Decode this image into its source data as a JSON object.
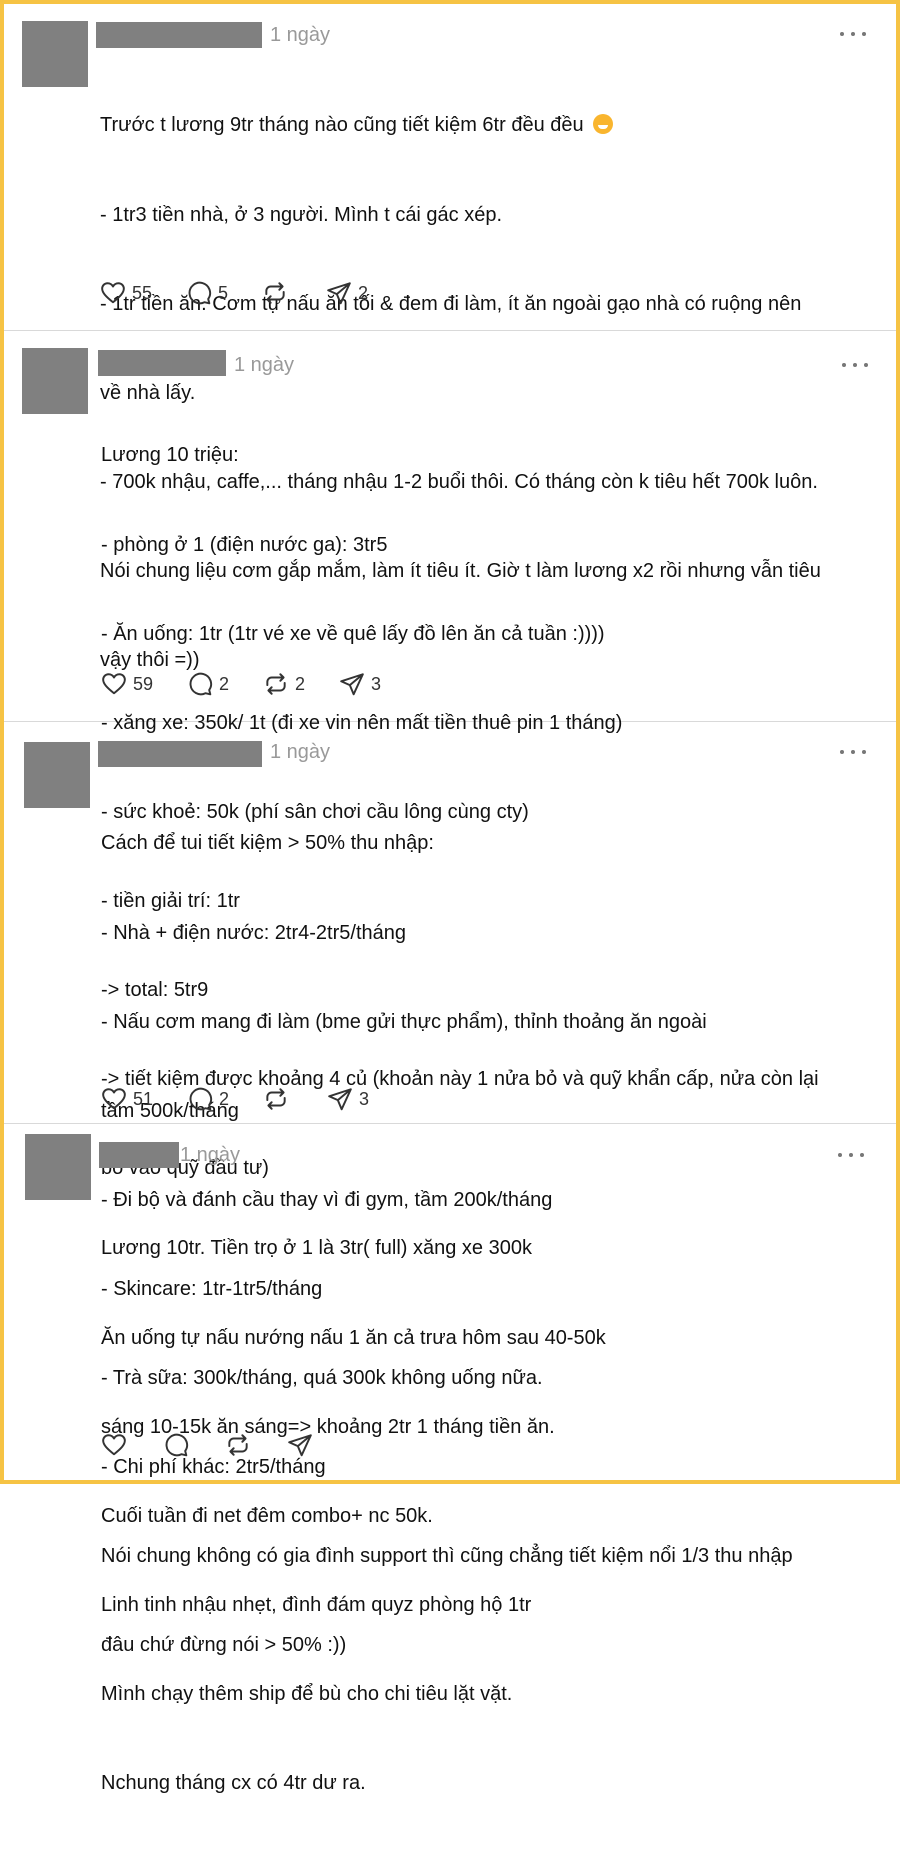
{
  "posts": [
    {
      "time": "1 ngày",
      "lines": [
        "Trước t lương 9tr tháng nào cũng tiết kiệm 6tr đều đều",
        "- 1tr3 tiền nhà, ở 3 người. Mình t cái gác xép.",
        "- 1tr tiền ăn. Cơm tự nấu ăn tối & đem đi làm, ít ăn ngoài gạo nhà có ruộng nên",
        "về nhà lấy.",
        "- 700k nhậu, caffe,... tháng nhậu 1-2 buổi thôi. Có tháng còn k tiêu hết 700k luôn.",
        "Nói chung liệu cơm gắp mắm, làm ít tiêu ít. Giờ t làm lương x2 rồi nhưng vẫn tiêu",
        "vậy thôi =))"
      ],
      "emoji": "grinning-sweat-emoji",
      "likes": "55",
      "replies": "5",
      "reposts": "",
      "shares": "2"
    },
    {
      "time": "1 ngày",
      "lines": [
        "Lương 10 triệu:",
        "- phòng ở 1 (điện nước ga): 3tr5",
        "- Ăn uống: 1tr (1tr vé xe về quê lấy đồ lên ăn cả tuần :))))",
        "- xăng xe: 350k/ 1t (đi xe vin nên mất tiền thuê pin 1 tháng)",
        "- sức khoẻ: 50k (phí sân chơi cầu lông cùng cty)",
        "- tiền giải trí: 1tr",
        "-> total: 5tr9",
        "-> tiết kiệm được khoảng 4 củ (khoản này 1 nửa bỏ và quỹ khẩn cấp, nửa còn lại",
        "bỏ vào quỹ đầu tư)"
      ],
      "likes": "59",
      "replies": "2",
      "reposts": "2",
      "shares": "3"
    },
    {
      "time": "1 ngày",
      "lines": [
        "Cách để tui tiết kiệm > 50% thu nhập:",
        "- Nhà + điện nước: 2tr4-2tr5/tháng",
        "- Nấu cơm mang đi làm (bme gửi thực phẩm), thỉnh thoảng ăn ngoài",
        "tầm 500k/tháng",
        "- Đi bộ và đánh cầu thay vì đi gym, tầm 200k/tháng",
        "- Skincare: 1tr-1tr5/tháng",
        "- Trà sữa: 300k/tháng, quá 300k không uống nữa.",
        "- Chi phí khác: 2tr5/tháng",
        "Nói chung không có gia đình support thì cũng chẳng tiết kiệm nổi 1/3 thu nhập",
        "đâu chứ đừng nói > 50% :))"
      ],
      "likes": "51",
      "replies": "2",
      "reposts": "",
      "shares": "3"
    },
    {
      "time": "1 ngày",
      "lines": [
        "Lương 10tr. Tiền trọ ở 1 là 3tr( full) xăng xe 300k",
        "Ăn uống tự nấu nướng nấu 1 ăn cả trưa hôm sau 40-50k",
        "sáng 10-15k ăn sáng=> khoảng 2tr 1 tháng tiền ăn.",
        "Cuối tuần đi net đêm combo+ nc 50k.",
        "Linh tinh nhậu nhẹt, đình đám quyz phòng hộ 1tr",
        "Mình chạy thêm ship để bù cho chi tiêu lặt vặt.",
        "Nchung tháng cx có 4tr dư ra."
      ],
      "likes": "",
      "replies": "",
      "reposts": "",
      "shares": ""
    }
  ],
  "colors": {
    "frame": "#f6c344",
    "redaction": "#808080",
    "muted": "#999999"
  }
}
